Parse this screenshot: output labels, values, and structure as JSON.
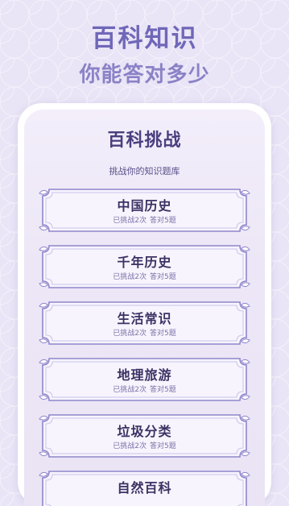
{
  "header": {
    "title": "百科知识",
    "subtitle": "你能答对多少"
  },
  "screen": {
    "title": "百科挑战",
    "subtitle": "挑战你的知识题库",
    "categories": [
      {
        "name": "中国历史",
        "challenged": "已挑战2次",
        "correct": "答对5题"
      },
      {
        "name": "千年历史",
        "challenged": "已挑战2次",
        "correct": "答对5题"
      },
      {
        "name": "生活常识",
        "challenged": "已挑战2次",
        "correct": "答对5题"
      },
      {
        "name": "地理旅游",
        "challenged": "已挑战2次",
        "correct": "答对5题"
      },
      {
        "name": "垃圾分类",
        "challenged": "已挑战2次",
        "correct": "答对5题"
      },
      {
        "name": "自然百科",
        "challenged": "",
        "correct": ""
      }
    ]
  },
  "colors": {
    "hero_title": "#6f67b8",
    "hero_subtitle": "#8a82c6",
    "card_border": "#8f86cc",
    "card_text": "#3b3264"
  }
}
